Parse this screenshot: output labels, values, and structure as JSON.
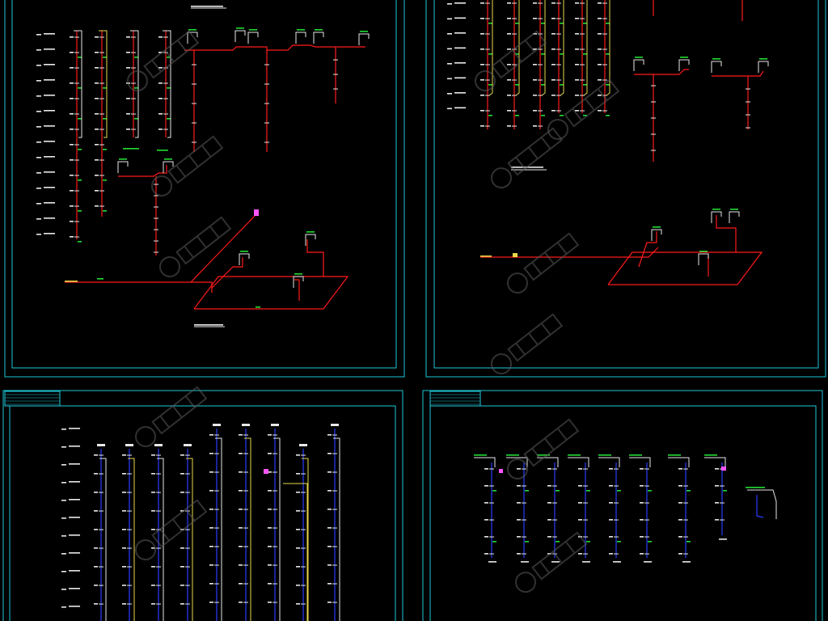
{
  "colors": {
    "background": "#000000",
    "frame": "#1ec8d8",
    "pipe": "#ff1a1a",
    "riser_alt": "#e8d84a",
    "riser_blue": "#2a3cff",
    "label": "#e8e8e8",
    "tag": "#22dd33",
    "mark": "#ff55ff",
    "watermark": "#5a5a5a"
  },
  "panels": [
    {
      "id": "top-left",
      "drawing": "floor-riser-diagram"
    },
    {
      "id": "top-right",
      "drawing": "riser-diagram"
    },
    {
      "id": "bottom-left",
      "drawing": "blue-riser-diagram"
    },
    {
      "id": "bottom-right",
      "drawing": "blue-riser-diagram"
    }
  ]
}
